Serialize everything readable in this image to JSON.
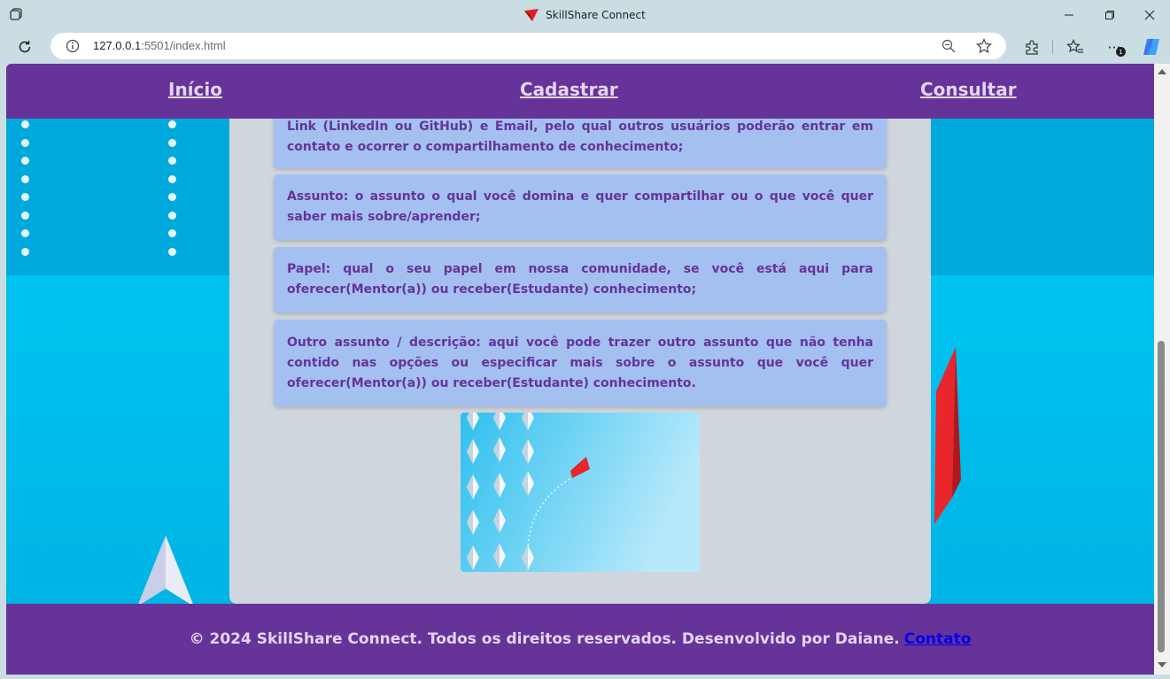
{
  "browser": {
    "window_title": "SkillShare Connect",
    "url_host": "127.0.0.1",
    "url_rest": ":5501/index.html",
    "more_badge": "1",
    "icons": [
      "tab-actions-icon",
      "favicon",
      "minimize-icon",
      "maximize-icon",
      "close-icon",
      "reload-icon",
      "info-icon",
      "zoom-out-icon",
      "favorite-star-icon",
      "extensions-icon",
      "favorites-icon",
      "more-icon",
      "copilot-icon"
    ]
  },
  "nav": {
    "inicio": "Início",
    "cadastrar": "Cadastrar",
    "consultar": "Consultar"
  },
  "info_boxes": [
    {
      "text": "Link (LinkedIn ou GitHub) e Email, pelo qual outros usuários poderão entrar em contato e ocorrer o compartilhamento de conhecimento;"
    },
    {
      "text": "Assunto: o assunto o qual você domina e quer compartilhar ou o que você quer saber mais sobre/aprender;"
    },
    {
      "text": "Papel: qual o seu papel em nossa comunidade, se você está aqui para oferecer(Mentor(a)) ou receber(Estudante) conhecimento;"
    },
    {
      "text": "Outro assunto / descrição: aqui você pode trazer outro assunto que não tenha contido nas opções ou especificar mais sobre o assunto que você quer oferecer(Mentor(a)) ou receber(Estudante) conhecimento."
    }
  ],
  "footer": {
    "text": "© 2024 SkillShare Connect. Todos os direitos reservados. Desenvolvido por Daiane.",
    "link": "Contato"
  },
  "colors": {
    "primary_purple": "#663399",
    "box_blue": "#a3c0f0",
    "card_gray": "#d0d6dd",
    "background_cyan": "#00b7e8"
  }
}
